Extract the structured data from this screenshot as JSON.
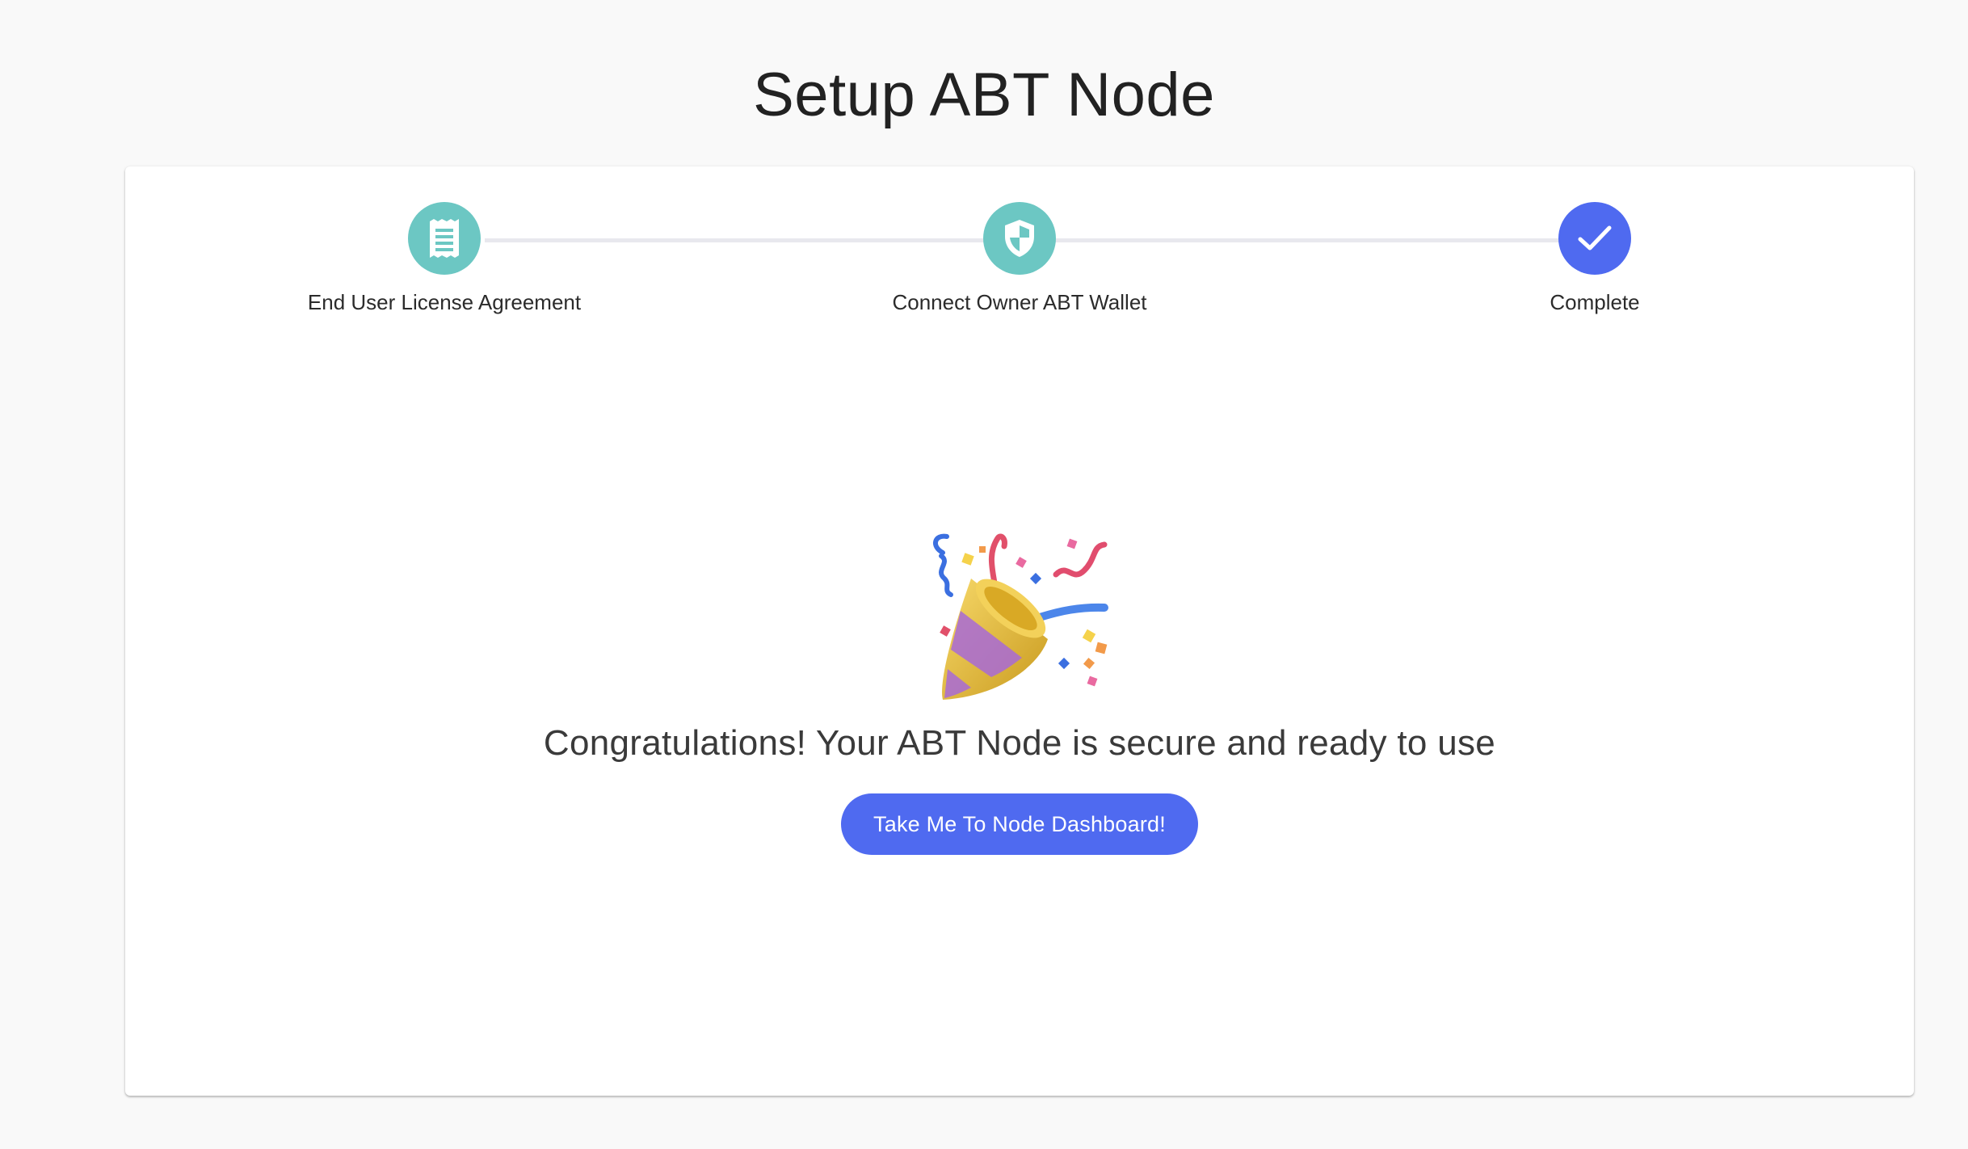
{
  "page": {
    "title": "Setup ABT Node"
  },
  "stepper": {
    "steps": [
      {
        "label": "End User License Agreement",
        "icon": "document-icon",
        "status": "completed",
        "color": "#6cc7c3"
      },
      {
        "label": "Connect Owner ABT Wallet",
        "icon": "shield-icon",
        "status": "completed",
        "color": "#6cc7c3"
      },
      {
        "label": "Complete",
        "icon": "check-icon",
        "status": "active",
        "color": "#4f6af0"
      }
    ]
  },
  "main": {
    "icon": "party-popper-icon",
    "message": "Congratulations! Your ABT Node is secure and ready to use",
    "button_label": "Take Me To Node Dashboard!"
  },
  "colors": {
    "background": "#f9f9f9",
    "card": "#ffffff",
    "completed_step": "#6cc7c3",
    "accent": "#4f6af0",
    "connector": "#e8e8ee"
  }
}
